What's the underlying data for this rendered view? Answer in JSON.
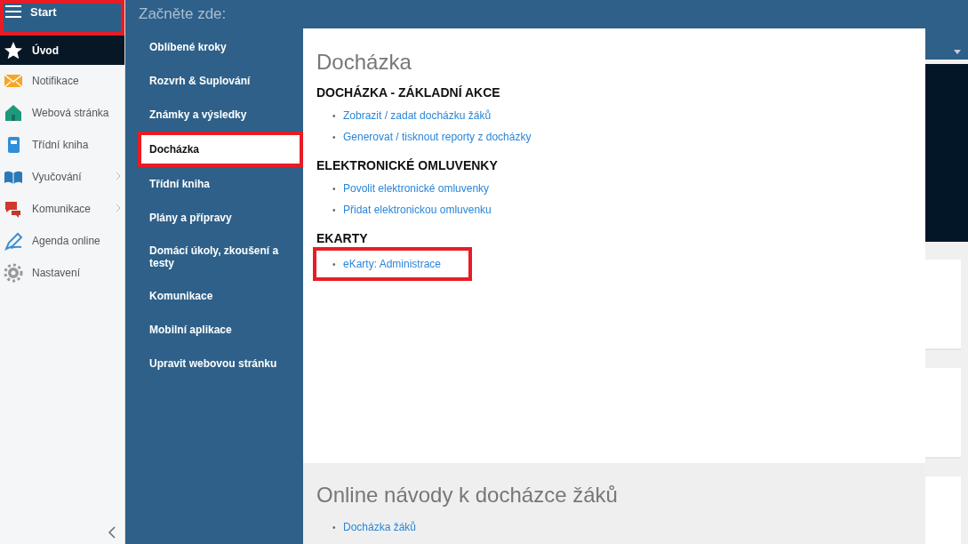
{
  "sidebar": {
    "header": {
      "label": "Start",
      "highlighted": true
    },
    "items": [
      {
        "label": "Úvod",
        "selected": true,
        "expandable": false
      },
      {
        "label": "Notifikace",
        "selected": false,
        "expandable": false
      },
      {
        "label": "Webová stránka",
        "selected": false,
        "expandable": false
      },
      {
        "label": "Třídní kniha",
        "selected": false,
        "expandable": false
      },
      {
        "label": "Vyučování",
        "selected": false,
        "expandable": true
      },
      {
        "label": "Komunikace",
        "selected": false,
        "expandable": true
      },
      {
        "label": "Agenda online",
        "selected": false,
        "expandable": false
      },
      {
        "label": "Nastavení",
        "selected": false,
        "expandable": false
      }
    ]
  },
  "menu": {
    "title": "Začněte zde:",
    "items": [
      {
        "label": "Oblíbené kroky",
        "selected": false,
        "highlighted": false
      },
      {
        "label": "Rozvrh & Suplování",
        "selected": false,
        "highlighted": false
      },
      {
        "label": "Známky a výsledky",
        "selected": false,
        "highlighted": false
      },
      {
        "label": "Docházka",
        "selected": true,
        "highlighted": true
      },
      {
        "label": "Třídní kniha",
        "selected": false,
        "highlighted": false
      },
      {
        "label": "Plány a přípravy",
        "selected": false,
        "highlighted": false
      },
      {
        "label": "Domácí úkoly, zkoušení a testy",
        "selected": false,
        "highlighted": false
      },
      {
        "label": "Komunikace",
        "selected": false,
        "highlighted": false
      },
      {
        "label": "Mobilní aplikace",
        "selected": false,
        "highlighted": false
      },
      {
        "label": "Upravit webovou stránku",
        "selected": false,
        "highlighted": false
      }
    ]
  },
  "panel": {
    "title": "Docházka",
    "bullet": "•",
    "sections": [
      {
        "heading": "DOCHÁZKA - ZÁKLADNÍ AKCE",
        "links": [
          {
            "label": "Zobrazit / zadat docházku žáků",
            "highlighted": false
          },
          {
            "label": "Generovat / tisknout reporty z docházky",
            "highlighted": false
          }
        ]
      },
      {
        "heading": "ELEKTRONICKÉ OMLUVENKY",
        "links": [
          {
            "label": "Povolit elektronické omluvenky",
            "highlighted": false
          },
          {
            "label": "Přidat elektronickou omluvenku",
            "highlighted": false
          }
        ]
      },
      {
        "heading": "EKARTY",
        "links": [
          {
            "label": "eKarty: Administrace",
            "highlighted": true
          }
        ]
      }
    ],
    "guides": {
      "title": "Online návody k docházce žáků",
      "links": [
        {
          "label": "Docházka žáků",
          "highlighted": false
        }
      ]
    }
  }
}
